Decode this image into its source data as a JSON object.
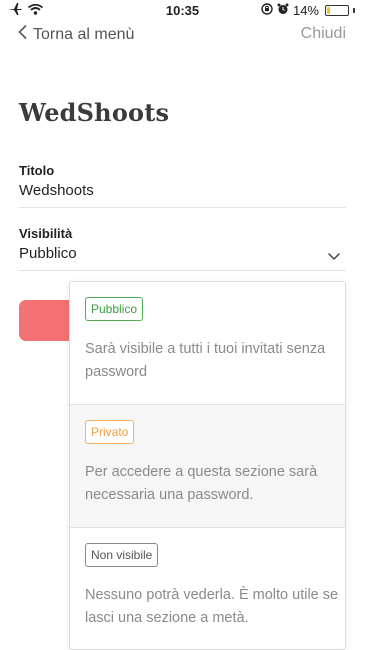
{
  "status_bar": {
    "time": "10:35",
    "battery_text": "14%",
    "battery_level": 0.14,
    "battery_color": "#f2c21b",
    "icons": [
      "airplane-icon",
      "wifi-icon",
      "rotation-lock-icon",
      "alarm-icon",
      "battery-icon"
    ]
  },
  "nav": {
    "back_label": "Torna al menù",
    "close_label": "Chiudi"
  },
  "page": {
    "title": "WedShoots"
  },
  "form": {
    "title_label": "Titolo",
    "title_value": "Wedshoots",
    "visibility_label": "Visibilità",
    "visibility_value": "Pubblico",
    "save_button_color": "#f47273"
  },
  "visibility_options": [
    {
      "badge": "Pubblico",
      "description": "Sarà visibile a tutti i tuoi invitati senza password",
      "color": "#4caf50"
    },
    {
      "badge": "Privato",
      "description": "Per accedere a questa sezione sarà necessaria una password.",
      "color": "#f3b25e"
    },
    {
      "badge": "Non visibile",
      "description": "Nessuno potrà vederla. È molto utile se lasci una sezione a metà.",
      "color": "#888888"
    }
  ]
}
